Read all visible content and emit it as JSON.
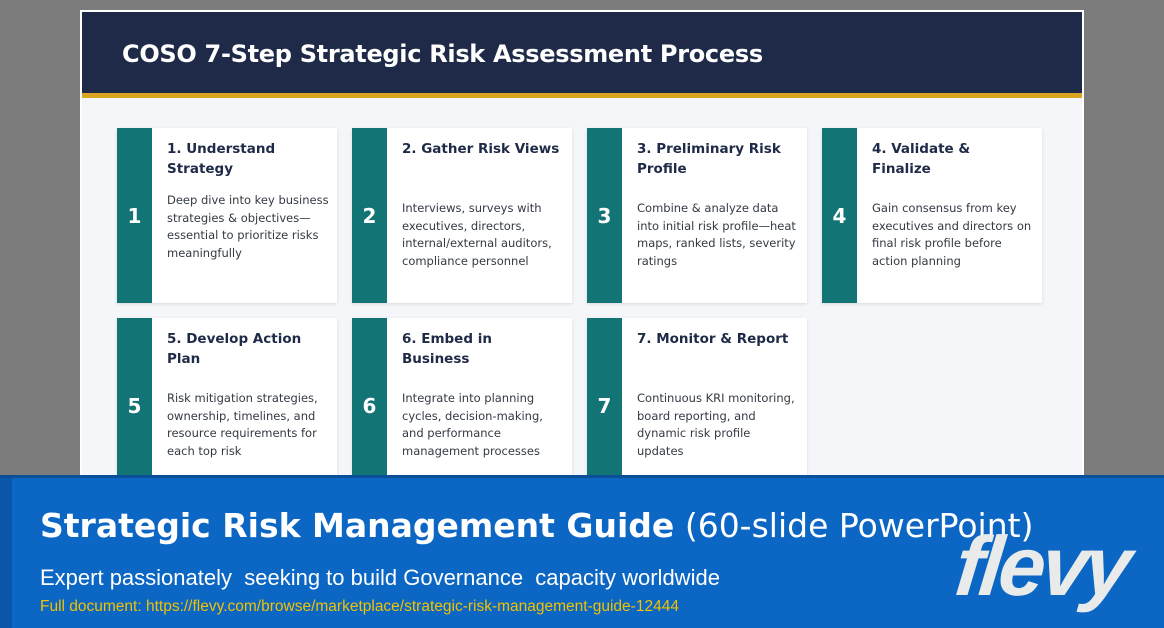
{
  "slide": {
    "title": "COSO 7-Step Strategic Risk Assessment Process",
    "colors": {
      "header": "#1e2a47",
      "accent_line": "#d9a521",
      "step_strip": "#127474"
    },
    "steps": [
      {
        "number": "1",
        "title": "1. Understand Strategy",
        "description": "Deep dive into key business strategies & objectives—essential to prioritize risks meaningfully"
      },
      {
        "number": "2",
        "title": "2. Gather Risk Views",
        "description": "Interviews, surveys with executives, directors, internal/external auditors, compliance personnel"
      },
      {
        "number": "3",
        "title": "3. Preliminary Risk Profile",
        "description": "Combine & analyze data into initial risk profile—heat maps, ranked lists, severity ratings"
      },
      {
        "number": "4",
        "title": "4. Validate & Finalize",
        "description": "Gain consensus from key executives and directors on final risk profile before action planning"
      },
      {
        "number": "5",
        "title": "5. Develop Action Plan",
        "description": "Risk mitigation strategies, ownership, timelines, and resource requirements for each top risk"
      },
      {
        "number": "6",
        "title": "6. Embed in Business",
        "description": "Integrate into planning cycles, decision-making, and performance management processes"
      },
      {
        "number": "7",
        "title": "7. Monitor & Report",
        "description": "Continuous KRI monitoring, board reporting, and dynamic risk profile updates"
      }
    ]
  },
  "banner": {
    "title_bold": "Strategic Risk Management Guide",
    "title_light": " (60-slide PowerPoint)",
    "subtitle": "Expert passionately  seeking to build Governance  capacity worldwide",
    "link_prefix": "Full document: ",
    "link_url": "https://flevy.com/browse/marketplace/strategic-risk-management-guide-12444",
    "logo": "flevy",
    "colors": {
      "background": "#0b66c4",
      "link": "#f2c200"
    }
  }
}
